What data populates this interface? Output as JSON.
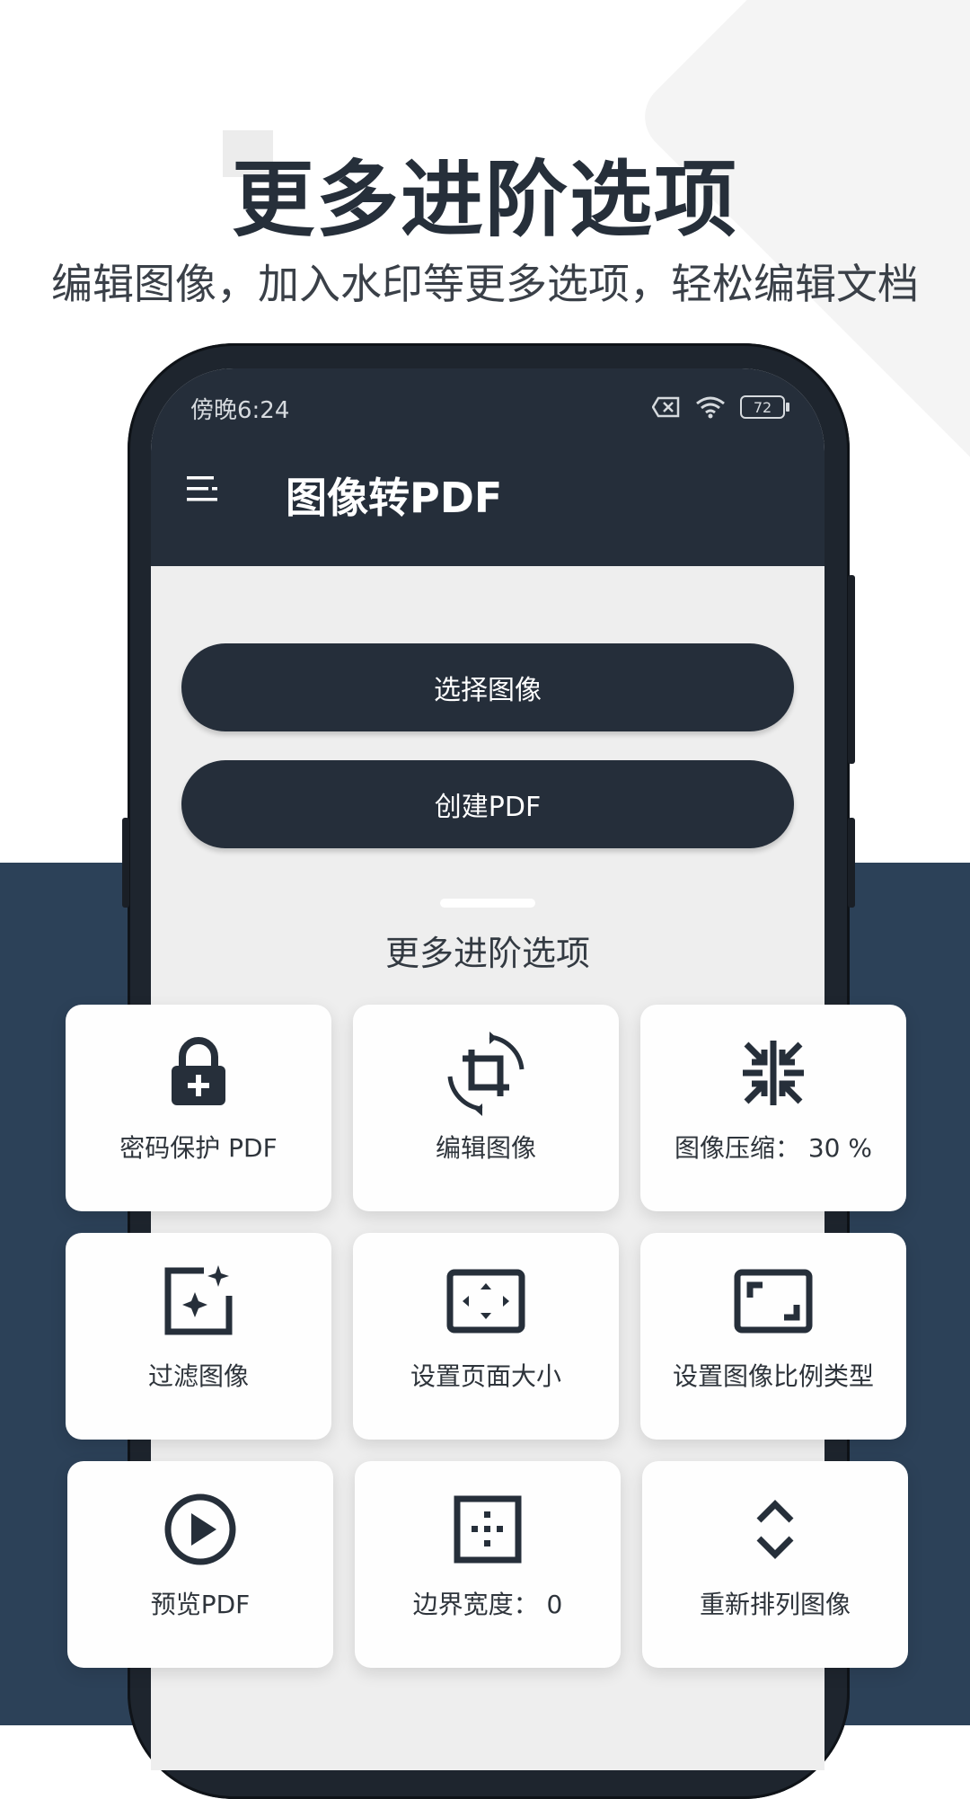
{
  "promo": {
    "headline": "更多进阶选项",
    "subheadline": "编辑图像，加入水印等更多选项，轻松编辑文档"
  },
  "status_bar": {
    "time": "傍晚6:24",
    "battery": "72"
  },
  "app_bar": {
    "title": "图像转PDF"
  },
  "actions": {
    "select_images": "选择图像",
    "create_pdf": "创建PDF"
  },
  "section": {
    "title": "更多进阶选项"
  },
  "options": [
    {
      "label": "密码保护 PDF",
      "icon": "lock-plus-icon"
    },
    {
      "label": "编辑图像",
      "icon": "crop-rotate-icon"
    },
    {
      "label": "图像压缩： 30 %",
      "icon": "compress-icon"
    },
    {
      "label": "过滤图像",
      "icon": "image-sparkle-icon"
    },
    {
      "label": "设置页面大小",
      "icon": "page-size-icon"
    },
    {
      "label": "设置图像比例类型",
      "icon": "aspect-ratio-icon"
    },
    {
      "label": "预览PDF",
      "icon": "play-circle-icon"
    },
    {
      "label": "边界宽度： 0",
      "icon": "border-width-icon"
    },
    {
      "label": "重新排列图像",
      "icon": "reorder-icon"
    }
  ],
  "colors": {
    "navy": "#2c4158",
    "app_dark": "#252e3a",
    "icon_dark": "#262f3a"
  }
}
